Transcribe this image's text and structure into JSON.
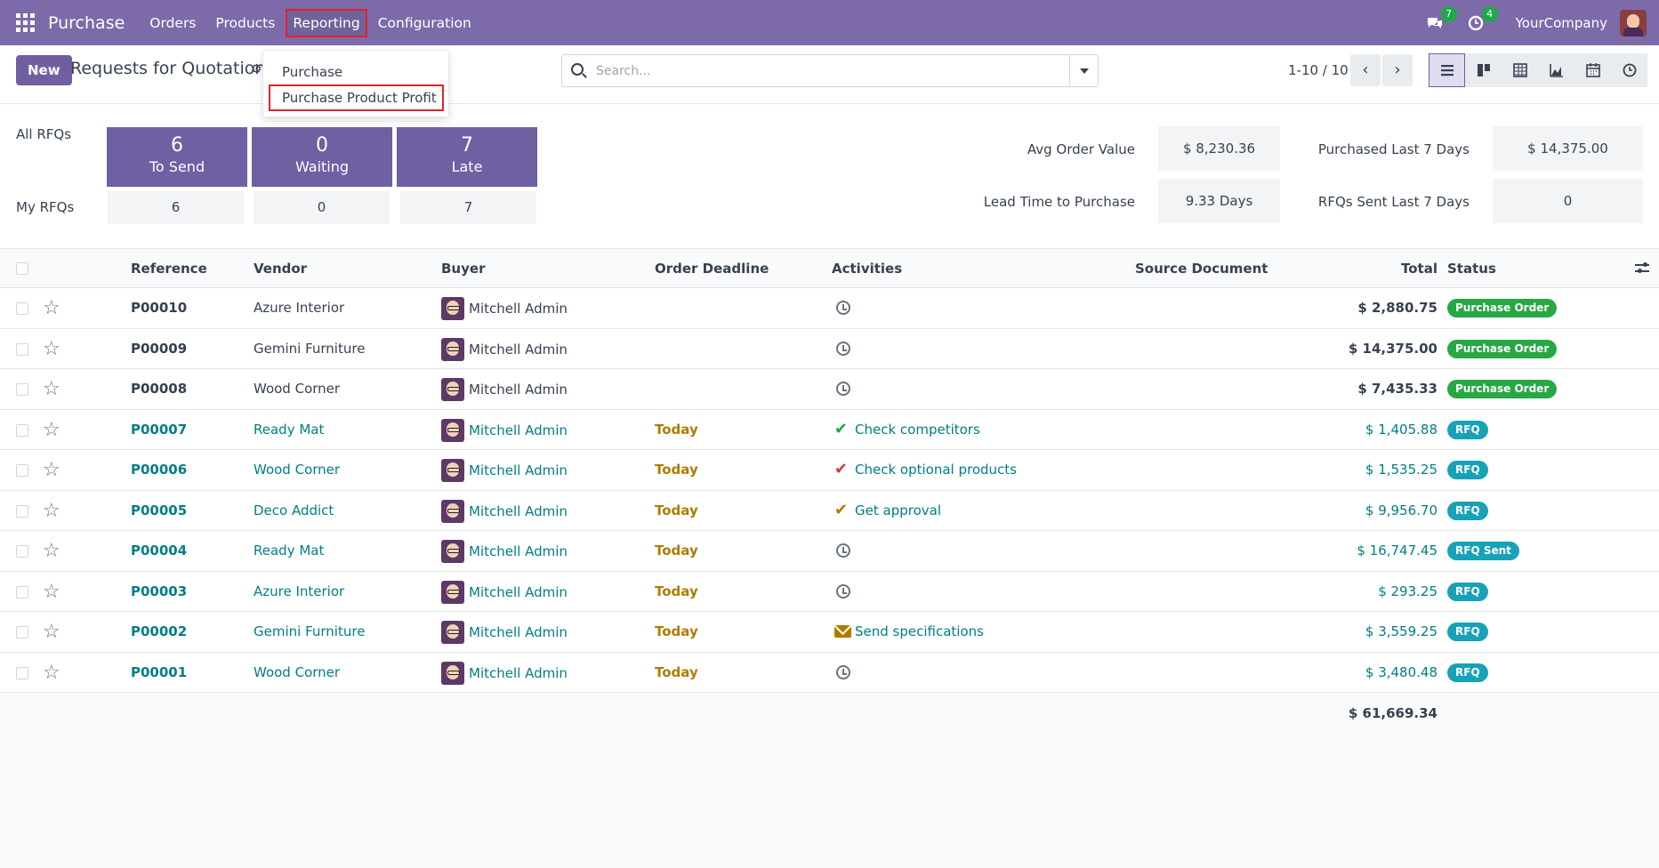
{
  "navbar": {
    "app_name": "Purchase",
    "menu": [
      "Orders",
      "Products",
      "Reporting",
      "Configuration"
    ],
    "chat_count": "7",
    "activity_count": "4",
    "company": "YourCompany"
  },
  "reporting_menu": {
    "items": [
      "Purchase",
      "Purchase Product Profit"
    ]
  },
  "control": {
    "new_label": "New",
    "title": "Requests for Quotation",
    "search_placeholder": "Search...",
    "pager": "1-10 / 10"
  },
  "dashboard": {
    "all_rfqs_label": "All RFQs",
    "my_rfqs_label": "My RFQs",
    "cards": [
      {
        "count": "6",
        "label": "To Send",
        "mine": "6"
      },
      {
        "count": "0",
        "label": "Waiting",
        "mine": "0"
      },
      {
        "count": "7",
        "label": "Late",
        "mine": "7"
      }
    ],
    "kpis": [
      {
        "label": "Avg Order Value",
        "value": "$ 8,230.36"
      },
      {
        "label": "Purchased Last 7 Days",
        "value": "$ 14,375.00"
      },
      {
        "label": "Lead Time to Purchase",
        "value": "9.33 Days"
      },
      {
        "label": "RFQs Sent Last 7 Days",
        "value": "0"
      }
    ]
  },
  "table": {
    "headers": {
      "reference": "Reference",
      "vendor": "Vendor",
      "buyer": "Buyer",
      "deadline": "Order Deadline",
      "activities": "Activities",
      "source": "Source Document",
      "total": "Total",
      "status": "Status"
    },
    "rows": [
      {
        "ref": "P00010",
        "vendor": "Azure Interior",
        "buyer": "Mitchell Admin",
        "deadline": "",
        "activity": "",
        "total": "$ 2,880.75",
        "status": "Purchase Order"
      },
      {
        "ref": "P00009",
        "vendor": "Gemini Furniture",
        "buyer": "Mitchell Admin",
        "deadline": "",
        "activity": "",
        "total": "$ 14,375.00",
        "status": "Purchase Order"
      },
      {
        "ref": "P00008",
        "vendor": "Wood Corner",
        "buyer": "Mitchell Admin",
        "deadline": "",
        "activity": "",
        "total": "$ 7,435.33",
        "status": "Purchase Order"
      },
      {
        "ref": "P00007",
        "vendor": "Ready Mat",
        "buyer": "Mitchell Admin",
        "deadline": "Today",
        "activity": "Check competitors",
        "total": "$ 1,405.88",
        "status": "RFQ"
      },
      {
        "ref": "P00006",
        "vendor": "Wood Corner",
        "buyer": "Mitchell Admin",
        "deadline": "Today",
        "activity": "Check optional products",
        "total": "$ 1,535.25",
        "status": "RFQ"
      },
      {
        "ref": "P00005",
        "vendor": "Deco Addict",
        "buyer": "Mitchell Admin",
        "deadline": "Today",
        "activity": "Get approval",
        "total": "$ 9,956.70",
        "status": "RFQ"
      },
      {
        "ref": "P00004",
        "vendor": "Ready Mat",
        "buyer": "Mitchell Admin",
        "deadline": "Today",
        "activity": "",
        "total": "$ 16,747.45",
        "status": "RFQ Sent"
      },
      {
        "ref": "P00003",
        "vendor": "Azure Interior",
        "buyer": "Mitchell Admin",
        "deadline": "Today",
        "activity": "",
        "total": "$ 293.25",
        "status": "RFQ"
      },
      {
        "ref": "P00002",
        "vendor": "Gemini Furniture",
        "buyer": "Mitchell Admin",
        "deadline": "Today",
        "activity": "Send specifications",
        "total": "$ 3,559.25",
        "status": "RFQ"
      },
      {
        "ref": "P00001",
        "vendor": "Wood Corner",
        "buyer": "Mitchell Admin",
        "deadline": "Today",
        "activity": "",
        "total": "$ 3,480.48",
        "status": "RFQ"
      }
    ],
    "grand_total": "$ 61,669.34"
  },
  "colors": {
    "navbar": "#7c6ba8",
    "primary": "#715ea0",
    "link": "#017e84",
    "deadline": "#b07b00",
    "badge_po": "#28a745",
    "badge_rfq": "#17a2b8"
  }
}
